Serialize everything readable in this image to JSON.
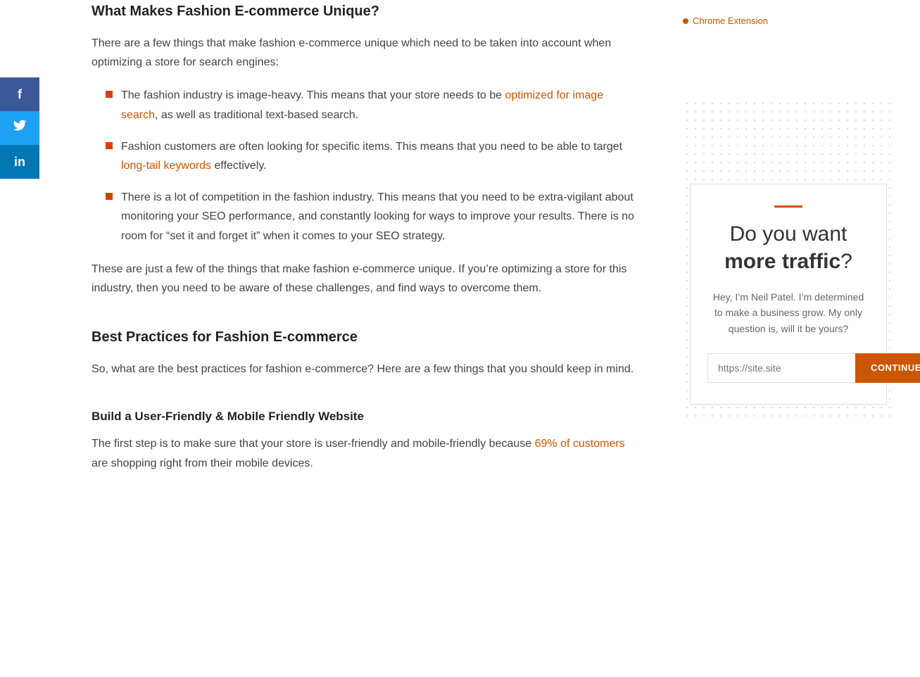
{
  "social": {
    "facebook_label": "f",
    "twitter_label": "t",
    "linkedin_label": "in"
  },
  "header": {
    "chrome_extension": "Chrome Extension"
  },
  "article": {
    "section1": {
      "heading": "What Makes Fashion E-commerce Unique?",
      "intro": "There are a few things that make fashion e-commerce unique which need to be taken into account when optimizing a store for search engines:",
      "bullets": [
        {
          "text_before": "The fashion industry is image-heavy. This means that your store needs to be ",
          "link_text": "optimized for image search",
          "text_after": ", as well as traditional text-based search."
        },
        {
          "text_before": "Fashion customers are often looking for specific items. This means that you need to be able to target ",
          "link_text": "long-tail keywords",
          "text_after": " effectively."
        },
        {
          "text_before": "There is a lot of competition in the fashion industry. This means that you need to be extra-vigilant about monitoring your SEO performance, and constantly looking for ways to improve your results. There is no room for “set it and forget it” when it comes to your SEO strategy.",
          "link_text": "",
          "text_after": ""
        }
      ],
      "closing": "These are just a few of the things that make fashion e-commerce unique. If you’re optimizing a store for this industry, then you need to be aware of these challenges, and find ways to overcome them."
    },
    "section2": {
      "heading": "Best Practices for Fashion E-commerce",
      "intro": "So, what are the best practices for fashion e-commerce? Here are a few things that you should keep in mind."
    },
    "section3": {
      "heading": "Build a User-Friendly & Mobile Friendly Website",
      "intro_before": "The first step is to make sure that your store is user-friendly and mobile-friendly because ",
      "link_text": "69% of customers",
      "intro_after": " are shopping right from their mobile devices."
    }
  },
  "widget": {
    "accent": "",
    "title_line1": "Do you want",
    "title_line2": "more traffic",
    "title_punctuation": "?",
    "description": "Hey, I’m Neil Patel. I’m determined to make a business grow. My only question is, will it be yours?",
    "input_placeholder": "https://site.site",
    "button_label": "CONTINUE"
  }
}
